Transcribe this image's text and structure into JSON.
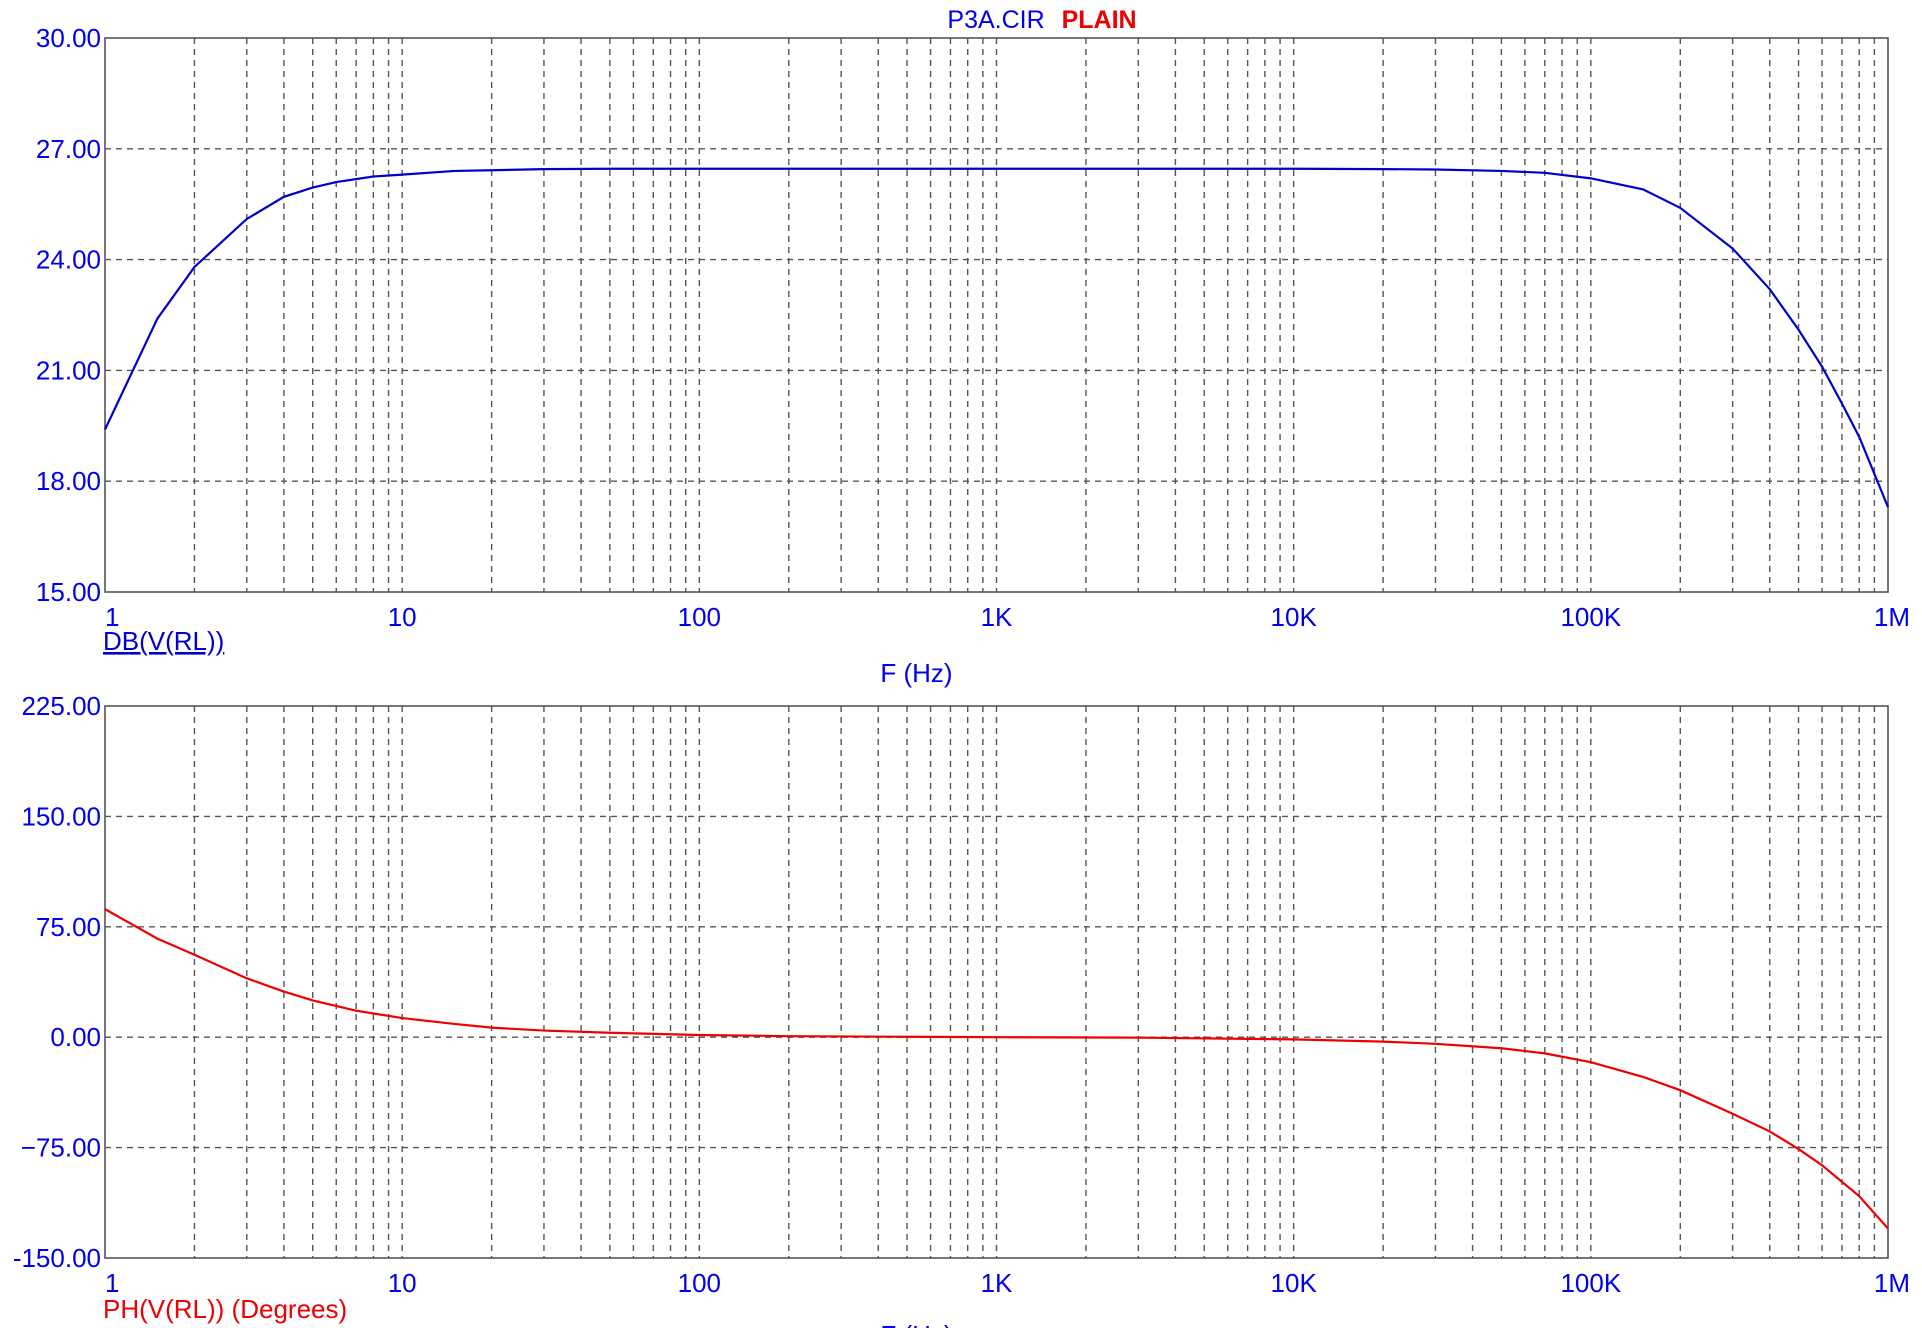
{
  "title": {
    "file": "P3A.CIR",
    "tag": "PLAIN",
    "file_color": "#0000ee",
    "tag_color": "#ee0000"
  },
  "chart_data": [
    {
      "type": "line",
      "x_scale": "log",
      "xlabel": "F (Hz)",
      "xlim": [
        1,
        1000000
      ],
      "x_ticks": [
        {
          "value": 1,
          "label": "1"
        },
        {
          "value": 10,
          "label": "10"
        },
        {
          "value": 100,
          "label": "100"
        },
        {
          "value": 1000,
          "label": "1K"
        },
        {
          "value": 10000,
          "label": "10K"
        },
        {
          "value": 100000,
          "label": "100K"
        },
        {
          "value": 1000000,
          "label": "1M"
        }
      ],
      "ylim": [
        15,
        30
      ],
      "y_ticks": [
        {
          "value": 15,
          "label": "15.00"
        },
        {
          "value": 18,
          "label": "18.00"
        },
        {
          "value": 21,
          "label": "21.00"
        },
        {
          "value": 24,
          "label": "24.00"
        },
        {
          "value": 27,
          "label": "27.00"
        },
        {
          "value": 30,
          "label": "30.00"
        }
      ],
      "grid": true,
      "legend_text": "DB(V(RL))",
      "series": [
        {
          "name": "DB(V(RL))",
          "color": "#0000cc",
          "x": [
            1,
            1.5,
            2,
            3,
            4,
            5,
            6,
            8,
            10,
            15,
            20,
            30,
            50,
            100,
            300,
            1000,
            3000,
            10000,
            20000,
            30000,
            50000,
            70000,
            100000,
            150000,
            200000,
            300000,
            400000,
            500000,
            600000,
            700000,
            800000,
            1000000
          ],
          "y": [
            19.4,
            22.4,
            23.8,
            25.1,
            25.7,
            25.95,
            26.1,
            26.25,
            26.3,
            26.4,
            26.42,
            26.45,
            26.46,
            26.46,
            26.46,
            26.46,
            26.46,
            26.46,
            26.45,
            26.44,
            26.4,
            26.35,
            26.2,
            25.9,
            25.4,
            24.3,
            23.2,
            22.1,
            21.1,
            20.1,
            19.2,
            17.3
          ]
        }
      ]
    },
    {
      "type": "line",
      "x_scale": "log",
      "xlabel": "F (Hz)",
      "xlim": [
        1,
        1000000
      ],
      "x_ticks": [
        {
          "value": 1,
          "label": "1"
        },
        {
          "value": 10,
          "label": "10"
        },
        {
          "value": 100,
          "label": "100"
        },
        {
          "value": 1000,
          "label": "1K"
        },
        {
          "value": 10000,
          "label": "10K"
        },
        {
          "value": 100000,
          "label": "100K"
        },
        {
          "value": 1000000,
          "label": "1M"
        }
      ],
      "ylim": [
        -150,
        225
      ],
      "y_ticks": [
        {
          "value": -150,
          "label": "-150.00"
        },
        {
          "value": -75,
          "label": "−75.00"
        },
        {
          "value": 0,
          "label": "0.00"
        },
        {
          "value": 75,
          "label": "75.00"
        },
        {
          "value": 150,
          "label": "150.00"
        },
        {
          "value": 225,
          "label": "225.00"
        }
      ],
      "grid": true,
      "legend_text": "PH(V(RL)) (Degrees)",
      "series": [
        {
          "name": "PH(V(RL)) (Degrees)",
          "color": "#ee0000",
          "x": [
            1,
            1.5,
            2,
            3,
            4,
            5,
            7,
            10,
            15,
            20,
            30,
            50,
            100,
            200,
            500,
            1000,
            3000,
            10000,
            20000,
            30000,
            50000,
            70000,
            100000,
            150000,
            200000,
            300000,
            400000,
            500000,
            600000,
            800000,
            1000000
          ],
          "y": [
            87,
            67,
            56,
            40,
            31,
            25,
            18,
            13,
            9,
            6.5,
            4.5,
            3,
            1.5,
            0.7,
            0.3,
            0,
            -0.3,
            -1.5,
            -3,
            -4.5,
            -7.5,
            -11,
            -17,
            -27,
            -36,
            -52,
            -64,
            -76,
            -87,
            -108,
            -130
          ]
        }
      ]
    }
  ]
}
